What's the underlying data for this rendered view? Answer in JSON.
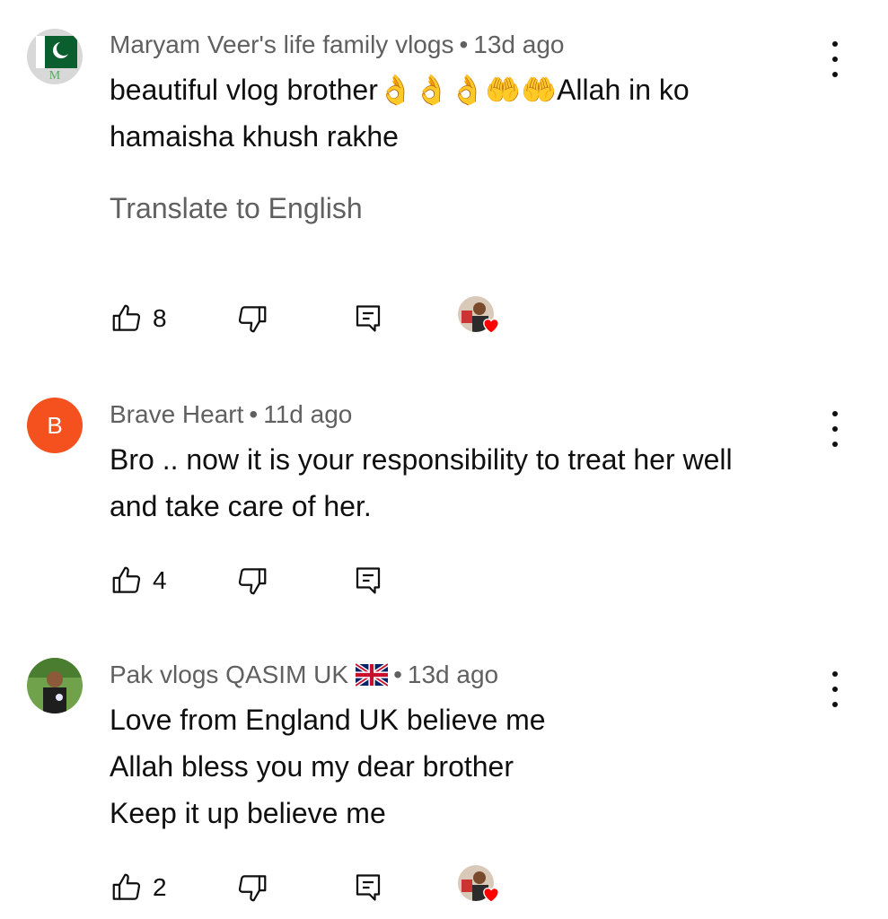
{
  "comments": [
    {
      "author": "Maryam Veer's life family vlogs",
      "time": "13d ago",
      "lines": [
        "beautiful vlog brother👌👌👌🤲🤲Allah in ko",
        "hamaisha khush rakhe"
      ],
      "translate_label": "Translate to English",
      "likes": "8",
      "hearted": true
    },
    {
      "author": "Brave Heart",
      "avatar_letter": "B",
      "time": "11d ago",
      "lines": [
        "Bro .. now it is your responsibility to treat her well",
        "and take care of her."
      ],
      "likes": "4",
      "hearted": false
    },
    {
      "author": "Pak vlogs QASIM UK",
      "time": "13d ago",
      "lines": [
        "Love from England UK believe me",
        "Allah bless you my dear brother",
        "Keep it up believe me"
      ],
      "likes": "2",
      "hearted": true
    }
  ],
  "separator": "•",
  "icons": {
    "like": "thumb-up-outline-icon",
    "dislike": "thumb-down-outline-icon",
    "reply": "comment-reply-icon",
    "more": "more-vert-icon",
    "heart": "creator-heart-icon",
    "flag": "uk-flag-icon"
  },
  "colors": {
    "text_primary": "#0f0f0f",
    "text_secondary": "#606060",
    "avatar_b": "#f4511e",
    "heart": "#ff0000"
  }
}
